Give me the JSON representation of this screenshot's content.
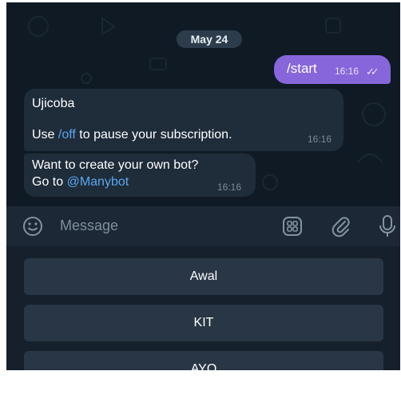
{
  "chat": {
    "date": "May 24",
    "messages": [
      {
        "from": "me",
        "text": "/start",
        "time": "16:16",
        "ticks": "✓✓"
      },
      {
        "from": "bot",
        "line1": "Ujicoba",
        "line2_pre": "Use ",
        "line2_cmd": "/off",
        "line2_post": " to pause your subscription.",
        "time": "16:16"
      },
      {
        "from": "bot",
        "line1": "Want to create your own bot?",
        "line2_pre": "Go to ",
        "line2_link": "@Manybot",
        "time": "16:16"
      }
    ]
  },
  "input": {
    "placeholder": "Message",
    "icons": [
      "emoji-icon",
      "bot-keyboard-icon",
      "attach-icon",
      "microphone-icon"
    ]
  },
  "keyboard": {
    "buttons": [
      "Awal",
      "KIT",
      "AYO"
    ]
  },
  "colors": {
    "chat_bg": "#0f1a24",
    "outgoing_bubble": "#8766db",
    "incoming_bubble": "#1f2c3a",
    "link": "#5aa7ee",
    "keyboard_button": "#293646"
  }
}
